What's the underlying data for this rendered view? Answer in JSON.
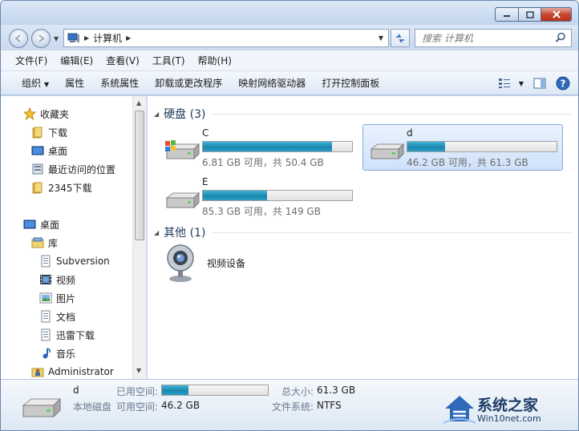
{
  "window": {
    "address_crumb": "计算机",
    "search_placeholder": "搜索 计算机"
  },
  "menu": [
    "文件(F)",
    "编辑(E)",
    "查看(V)",
    "工具(T)",
    "帮助(H)"
  ],
  "toolbar": {
    "organize": "组织",
    "properties": "属性",
    "system_properties": "系统属性",
    "uninstall": "卸载或更改程序",
    "map_drive": "映射网络驱动器",
    "control_panel": "打开控制面板"
  },
  "sidebar": {
    "favorites": "收藏夹",
    "downloads": "下载",
    "desktop": "桌面",
    "recent": "最近访问的位置",
    "downloads_2345": "2345下载",
    "desktop_root": "桌面",
    "libraries": "库",
    "subversion": "Subversion",
    "videos": "视频",
    "pictures": "图片",
    "documents": "文档",
    "thunder": "迅雷下载",
    "music": "音乐",
    "administrator": "Administrator"
  },
  "groups": {
    "hard_disks": "硬盘 (3)",
    "other": "其他 (1)"
  },
  "drives": [
    {
      "name": "C",
      "used_fraction": 0.865,
      "info": "6.81 GB 可用，共 50.4 GB"
    },
    {
      "name": "d",
      "used_fraction": 0.25,
      "info": "46.2 GB 可用，共 61.3 GB"
    },
    {
      "name": "E",
      "used_fraction": 0.43,
      "info": "85.3 GB 可用，共 149 GB"
    }
  ],
  "device": {
    "name": "视频设备"
  },
  "details": {
    "name": "d",
    "type": "本地磁盘",
    "used_label": "已用空间:",
    "used_fraction": 0.25,
    "free_label": "可用空间:",
    "free_value": "46.2 GB",
    "total_label": "总大小:",
    "total_value": "61.3 GB",
    "fs_label": "文件系统:",
    "fs_value": "NTFS"
  },
  "watermark": {
    "brand": "系统之家",
    "site": "Win10net.com"
  }
}
